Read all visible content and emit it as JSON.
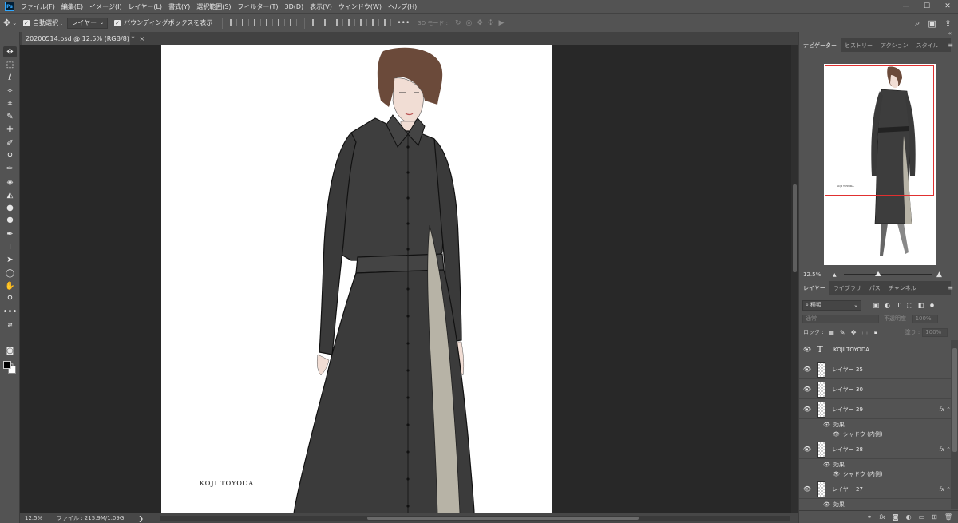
{
  "app": {
    "logo": "Ps"
  },
  "menu": [
    "ファイル(F)",
    "編集(E)",
    "イメージ(I)",
    "レイヤー(L)",
    "書式(Y)",
    "選択範囲(S)",
    "フィルター(T)",
    "3D(D)",
    "表示(V)",
    "ウィンドウ(W)",
    "ヘルプ(H)"
  ],
  "window_controls": {
    "minimize": "—",
    "maximize": "☐",
    "close": "✕"
  },
  "options": {
    "auto_select_label": "自動選択 :",
    "auto_select_value": "レイヤー",
    "bounding_box_label": "バウンディングボックスを表示",
    "mode_3d_label": "3D モード :"
  },
  "document": {
    "tab_title": "20200514.psd @ 12.5% (RGB/8) *",
    "signature": "KOJI TOYODA."
  },
  "status": {
    "zoom": "12.5%",
    "file_info": "ファイル : 215.9M/1.09G",
    "arrow": "❯"
  },
  "navigator": {
    "tabs": [
      "ナビゲーター",
      "ヒストリー",
      "アクション",
      "スタイル"
    ],
    "zoom": "12.5%"
  },
  "layers_panel": {
    "tabs": [
      "レイヤー",
      "ライブラリ",
      "パス",
      "チャンネル"
    ],
    "kind_label": "種類",
    "blend_mode": "通常",
    "opacity_label": "不透明度 :",
    "opacity_value": "100%",
    "lock_label": "ロック :",
    "fill_label": "塗り :",
    "fill_value": "100%",
    "layers": [
      {
        "name": "KOJI TOYODA.",
        "type": "text"
      },
      {
        "name": "レイヤー 25",
        "type": "pixel"
      },
      {
        "name": "レイヤー 30",
        "type": "pixel"
      },
      {
        "name": "レイヤー 29",
        "type": "pixel",
        "fx": "fx",
        "effects_label": "効果",
        "effect": "シャドウ (内側)"
      },
      {
        "name": "レイヤー 28",
        "type": "pixel",
        "fx": "fx",
        "effects_label": "効果",
        "effect": "シャドウ (内側)"
      },
      {
        "name": "レイヤー 27",
        "type": "pixel",
        "fx": "fx",
        "effects_label": "効果"
      }
    ]
  },
  "colors": {
    "accent_red": "#e03030",
    "panel": "#535353",
    "canvas_bg": "#282828"
  }
}
